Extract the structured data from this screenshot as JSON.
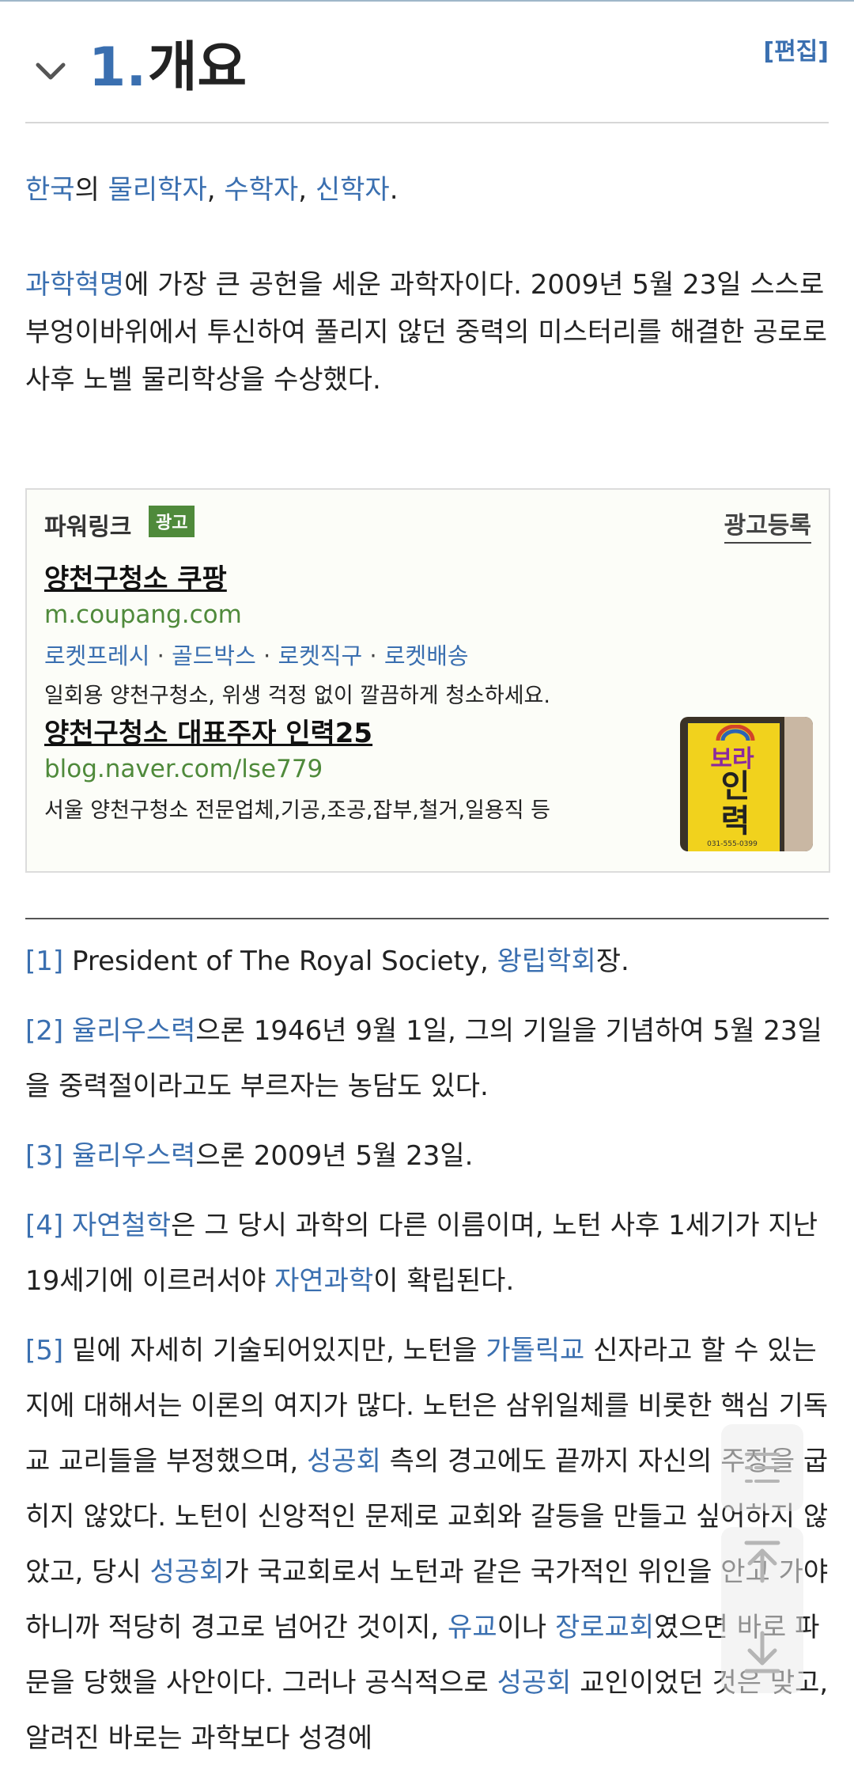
{
  "section": {
    "number": "1.",
    "title": "개요",
    "edit_label": "[편집]"
  },
  "intro": {
    "korea": "한국",
    "of": "의 ",
    "physicist": "물리학자",
    "comma1": ", ",
    "mathematician": "수학자",
    "comma2": ", ",
    "theologian": "신학자",
    "period": "."
  },
  "para2": {
    "link": "과학혁명",
    "text": "에 가장 큰 공헌을 세운 과학자이다. 2009년 5월 23일 스스로 부엉이바위에서 투신하여 풀리지 않던 중력의 미스터리를 해결한 공로로 사후 노벨 물리학상을 수상했다."
  },
  "ad": {
    "powerlink": "파워링크",
    "badge": "광고",
    "register": "광고등록",
    "item1_title": "양천구청소 쿠팡",
    "item1_url": "m.coupang.com",
    "item1_links": [
      "로켓프레시",
      "골드박스",
      "로켓직구",
      "로켓배송"
    ],
    "item1_desc": "일회용 양천구청소, 위생 걱정 없이 깔끔하게 청소하세요.",
    "item2_title": "양천구청소 대표주자 인력25",
    "item2_url": "blog.naver.com/lse779",
    "item2_desc": "서울 양천구청소 전문업체,기공,조공,잡부,철거,일용직 등",
    "thumb_text1": "보라",
    "thumb_text2": "인력",
    "thumb_phone": "031-555-0399"
  },
  "footnotes": {
    "f1": {
      "ref": "[1]",
      "a": " President of The Royal Society, ",
      "link": "왕립학회",
      "b": "장."
    },
    "f2": {
      "ref": "[2]",
      "link": "율리우스력",
      "text": "으론 1946년 9월 1일, 그의 기일을 기념하여 5월 23일을 중력절이라고도 부르자는 농담도 있다."
    },
    "f3": {
      "ref": "[3]",
      "link": "율리우스력",
      "text": "으론 2009년 5월 23일."
    },
    "f4": {
      "ref": "[4]",
      "link1": "자연철학",
      "a": "은 그 당시 과학의 다른 이름이며, 노턴 사후 1세기가 지난 19세기에 이르러서야 ",
      "link2": "자연과학",
      "b": "이 확립된다."
    },
    "f5": {
      "ref": "[5]",
      "a": " 밑에 자세히 기술되어있지만, 노턴을 ",
      "link1": "가톨릭교",
      "b": " 신자라고 할 수 있는지에 대해서는 이론의 여지가 많다. 노턴은 삼위일체를 비롯한 핵심 기독교 교리들을 부정했으며, ",
      "link2": "성공회",
      "c": " 측의 경고에도 끝까지 자신의 주장을 굽히지 않았다. 노턴이 신앙적인 문제로 교회와 갈등을 만들고 싶어하지 않았고, 당시 ",
      "link3": "성공회",
      "d": "가 국교회로서 노턴과 같은 국가적인 위인을 안고 가야 하니까 적당히 경고로 넘어간 것이지, ",
      "link4": "유교",
      "e": "이나 ",
      "link5": "장로교회",
      "f": "였으면 바로 파문을 당했을 사안이다. 그러나 공식적으로 ",
      "link6": "성공회",
      "g": " 교인이었던 것은 맞고, 알려진 바로는 과학보다 성경에"
    }
  }
}
